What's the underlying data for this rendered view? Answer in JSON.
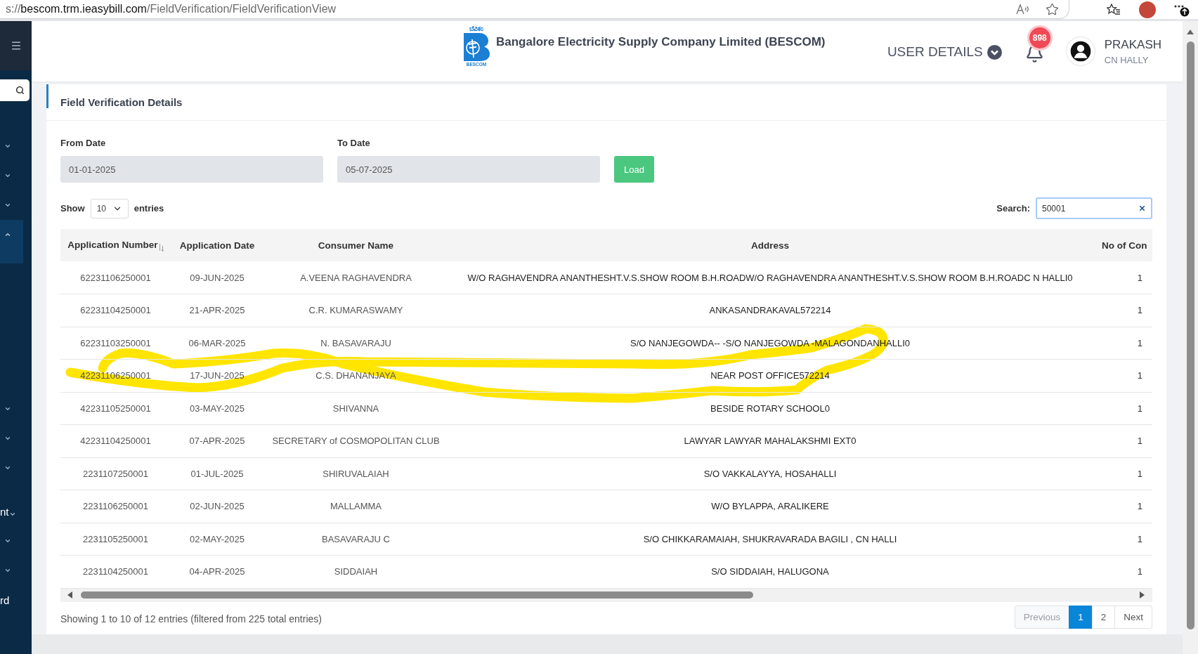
{
  "browser": {
    "url": {
      "scheme": "s://",
      "host": "bescom.trm.ieasybill.com",
      "path": "/FieldVerification/FieldVerificationView"
    }
  },
  "sidebar": {
    "items": [
      {
        "kind": "group",
        "expanded": false
      },
      {
        "kind": "group",
        "expanded": false
      },
      {
        "kind": "group",
        "expanded": false
      },
      {
        "kind": "group",
        "expanded": true
      },
      {
        "kind": "group",
        "expanded": false
      },
      {
        "kind": "group",
        "expanded": false
      },
      {
        "kind": "group",
        "expanded": false
      },
      {
        "kind": "group",
        "label": "nt",
        "expanded": false
      },
      {
        "kind": "group",
        "expanded": false
      },
      {
        "kind": "group",
        "expanded": false
      },
      {
        "kind": "link",
        "label": "rd"
      }
    ]
  },
  "header": {
    "logo": {
      "caption": "ಬೆವಿಕಂ",
      "wordmark": "BESCOM"
    },
    "title": "Bangalore Electricity Supply Company Limited (BESCOM)",
    "user_menu": "USER DETAILS",
    "notifications": "898",
    "user": {
      "name": "PRAKASH",
      "location": "CN HALLY"
    }
  },
  "panel": {
    "title": "Field Verification Details",
    "filters": [
      {
        "label": "From Date",
        "value": "01-01-2025"
      },
      {
        "label": "To Date",
        "value": "05-07-2025"
      }
    ],
    "load_button": "Load",
    "length": {
      "prefix": "Show",
      "value": "10",
      "suffix": "entries"
    },
    "search": {
      "label": "Search:",
      "value": "50001"
    },
    "table": {
      "columns": [
        {
          "label": "Application Number",
          "sorted": true
        },
        {
          "label": "Application Date",
          "sorted": false
        },
        {
          "label": "Consumer Name",
          "sorted": false
        },
        {
          "label": "Address",
          "sorted": false
        },
        {
          "label": "No of Con",
          "sorted": false
        }
      ],
      "rows": [
        [
          "62231106250001",
          "09-JUN-2025",
          "A.VEENA RAGHAVENDRA",
          "W/O RAGHAVENDRA ANANTHESHT.V.S.SHOW ROOM B.H.ROADW/O RAGHAVENDRA ANANTHESHT.V.S.SHOW ROOM B.H.ROADC N HALLI0",
          "1"
        ],
        [
          "62231104250001",
          "21-APR-2025",
          "C.R. KUMARASWAMY",
          "ANKASANDRAKAVAL572214",
          "1"
        ],
        [
          "62231103250001",
          "06-MAR-2025",
          "N. BASAVARAJU",
          "S/O NANJEGOWDA-- -S/O NANJEGOWDA -MALAGONDANHALLI0",
          "1"
        ],
        [
          "42231106250001",
          "17-JUN-2025",
          "C.S. DHANANJAYA",
          "NEAR POST OFFICE572214",
          "1"
        ],
        [
          "42231105250001",
          "03-MAY-2025",
          "SHIVANNA",
          "BESIDE ROTARY SCHOOL0",
          "1"
        ],
        [
          "42231104250001",
          "07-APR-2025",
          "SECRETARY of COSMOPOLITAN CLUB",
          "LAWYAR LAWYAR MAHALAKSHMI EXT0",
          "1"
        ],
        [
          "2231107250001",
          "01-JUL-2025",
          "SHIRUVALAIAH",
          "S/O VAKKALAYYA, HOSAHALLI",
          "1"
        ],
        [
          "2231106250001",
          "02-JUN-2025",
          "MALLAMMA",
          "W/O BYLAPPA, ARALIKERE",
          "1"
        ],
        [
          "2231105250001",
          "02-MAY-2025",
          "BASAVARAJU C",
          "S/O CHIKKARAMAIAH, SHUKRAVARADA BAGILI , CN HALLI",
          "1"
        ],
        [
          "2231104250001",
          "04-APR-2025",
          "SIDDAIAH",
          "S/O SIDDAIAH, HALUGONA",
          "1"
        ]
      ]
    },
    "info": "Showing 1 to 10 of 12 entries (filtered from 225 total entries)",
    "pagination": [
      {
        "label": "Previous",
        "selected": false,
        "disabled": true
      },
      {
        "label": "1",
        "selected": true,
        "disabled": false
      },
      {
        "label": "2",
        "selected": false,
        "disabled": false
      },
      {
        "label": "Next",
        "selected": false,
        "disabled": false
      }
    ]
  }
}
